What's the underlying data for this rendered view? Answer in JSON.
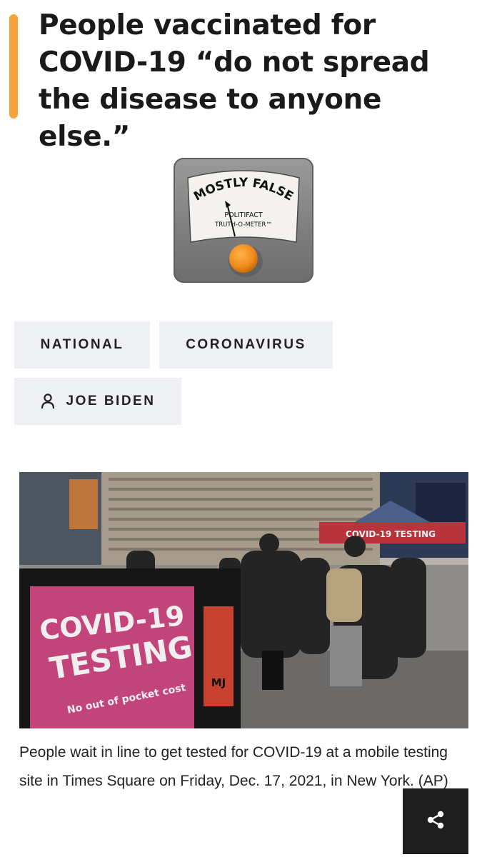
{
  "headline": {
    "line1": "People vaccinated for",
    "line2": "COVID-19 “do not spread",
    "line3": "the disease to anyone else.”"
  },
  "meter": {
    "rating": "MOSTLY FALSE",
    "brand_line1": "POLITIFACT",
    "brand_line2": "TRUTH-O-METER™",
    "knob_color": "#f08a1c"
  },
  "tags": {
    "national": "NATIONAL",
    "coronavirus": "CORONAVIRUS",
    "speaker": "JOE BIDEN"
  },
  "photo": {
    "sign_line1": "COVID-19",
    "sign_line2": "TESTING",
    "sign_line3": "No out of pocket cost",
    "tent_banner": "COVID-19 TESTING",
    "theater_sign": "MJ",
    "sign_color": "#c2447a"
  },
  "caption": "People wait in line to get tested for COVID-19 at a mobile testing site in Times Square on Friday, Dec. 17, 2021, in New York. (AP)",
  "colors": {
    "accent": "#f4a23a",
    "tag_bg": "#eef0f3",
    "share_bg": "#1e1e1e"
  },
  "icons": {
    "person": "person-icon",
    "share": "share-icon"
  }
}
